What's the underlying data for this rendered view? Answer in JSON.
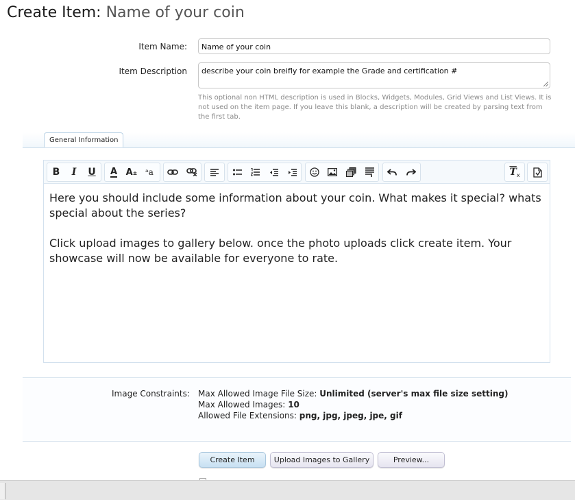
{
  "header": {
    "title": "Create Item:",
    "subtitle": "Name of your coin"
  },
  "form": {
    "item_name": {
      "label": "Item Name:",
      "value": "Name of your coin"
    },
    "item_description": {
      "label": "Item Description",
      "value": "describe your coin breifly for example the Grade and certification #",
      "hint": "This optional non HTML description is used in Blocks, Widgets, Modules, Grid Views and List Views. It is not used on the item page. If you leave this blank, a description will be created by parsing text from the first tab."
    }
  },
  "tabs": [
    {
      "label": "General Information",
      "active": true
    }
  ],
  "editor": {
    "toolbar_icons": [
      "bold-icon",
      "italic-icon",
      "underline-icon",
      "text-color-icon",
      "font-size-icon",
      "font-family-icon",
      "link-icon",
      "unlink-icon",
      "align-icon",
      "bullet-list-icon",
      "numbered-list-icon",
      "outdent-icon",
      "indent-icon",
      "smilie-icon",
      "image-icon",
      "media-icon",
      "insert-icon",
      "undo-icon",
      "redo-icon",
      "remove-format-icon",
      "toggle-bbcode-icon"
    ],
    "paragraphs": [
      "Here you should include some information about your coin. What makes it special? whats special about the series?",
      "Click upload images to gallery below. once the photo uploads click create item. Your showcase will now be available for everyone to rate."
    ]
  },
  "constraints": {
    "label": "Image Constraints:",
    "max_file_size": {
      "label": "Max Allowed Image File Size:",
      "value": "Unlimited (server's max file size setting)"
    },
    "max_images": {
      "label": "Max Allowed Images:",
      "value": "10"
    },
    "extensions": {
      "label": "Allowed File Extensions:",
      "value": "png, jpg, jpeg, jpe, gif"
    }
  },
  "buttons": {
    "create": "Create Item",
    "upload": "Upload Images to Gallery",
    "preview": "Preview..."
  }
}
